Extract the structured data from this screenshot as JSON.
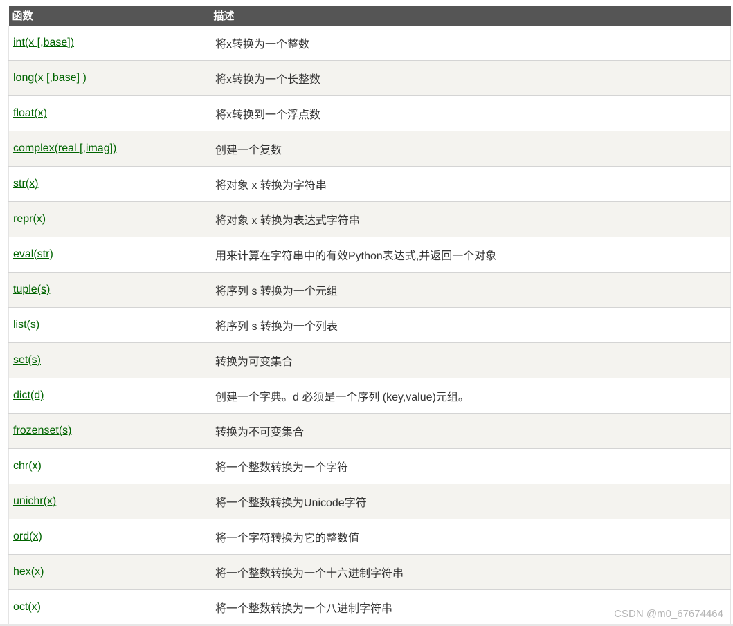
{
  "table": {
    "headers": {
      "function": "函数",
      "description": "描述"
    },
    "rows": [
      {
        "func": "int(x [,base])",
        "desc": "将x转换为一个整数"
      },
      {
        "func": "long(x [,base] )",
        "desc": "将x转换为一个长整数"
      },
      {
        "func": "float(x)",
        "desc": "将x转换到一个浮点数"
      },
      {
        "func": "complex(real [,imag])",
        "desc": "创建一个复数"
      },
      {
        "func": "str(x)",
        "desc": "将对象 x 转换为字符串"
      },
      {
        "func": "repr(x)",
        "desc": "将对象 x 转换为表达式字符串"
      },
      {
        "func": "eval(str)",
        "desc": "用来计算在字符串中的有效Python表达式,并返回一个对象"
      },
      {
        "func": "tuple(s)",
        "desc": "将序列 s 转换为一个元组"
      },
      {
        "func": "list(s)",
        "desc": "将序列 s 转换为一个列表"
      },
      {
        "func": "set(s)",
        "desc": "转换为可变集合"
      },
      {
        "func": "dict(d)",
        "desc": "创建一个字典。d 必须是一个序列 (key,value)元组。"
      },
      {
        "func": "frozenset(s)",
        "desc": "转换为不可变集合"
      },
      {
        "func": "chr(x)",
        "desc": "将一个整数转换为一个字符"
      },
      {
        "func": "unichr(x)",
        "desc": "将一个整数转换为Unicode字符"
      },
      {
        "func": "ord(x)",
        "desc": "将一个字符转换为它的整数值"
      },
      {
        "func": "hex(x)",
        "desc": "将一个整数转换为一个十六进制字符串"
      },
      {
        "func": "oct(x)",
        "desc": "将一个整数转换为一个八进制字符串"
      }
    ]
  },
  "watermark": "CSDN @m0_67674464",
  "colors": {
    "header_bg": "#555555",
    "header_text": "#ffffff",
    "link": "#006400",
    "row_alt_bg": "#f4f3ef",
    "watermark": "#b4b4b4"
  }
}
